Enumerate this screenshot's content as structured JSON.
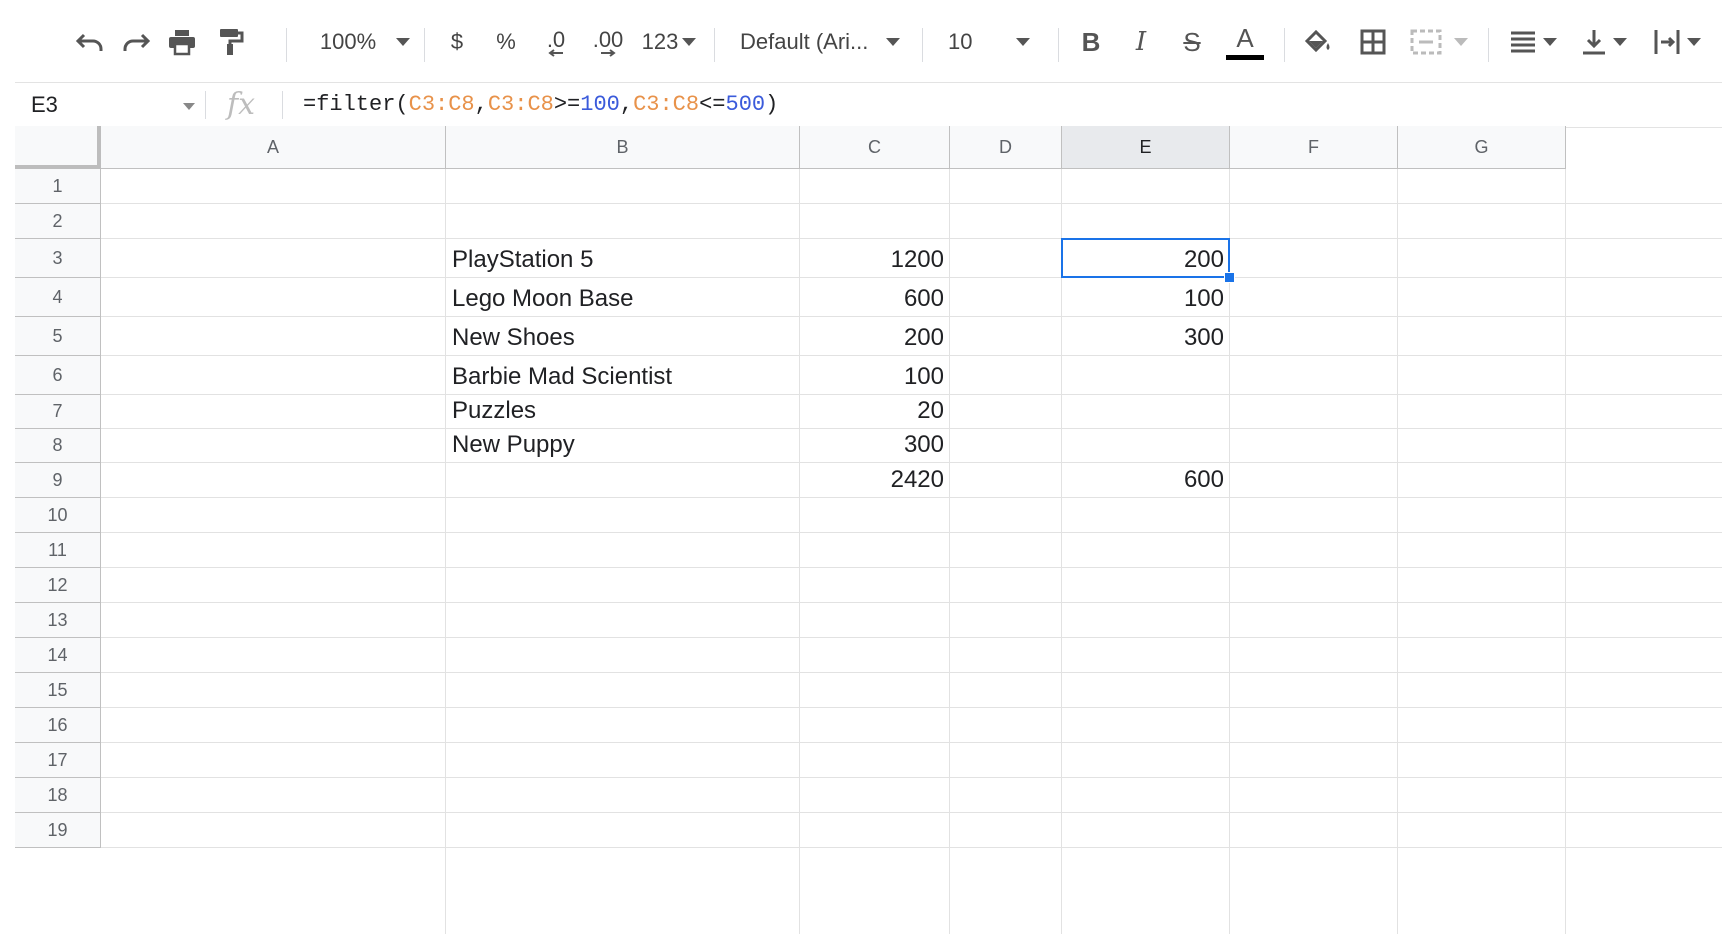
{
  "toolbar": {
    "zoom": "100%",
    "currency_label": "$",
    "percent_label": "%",
    "decrease_decimal_label": ".0",
    "increase_decimal_label": ".00",
    "more_formats_label": "123",
    "font_family": "Default (Ari...",
    "font_size": "10",
    "text_color_swatch": "#000000"
  },
  "formula_bar": {
    "name_box": "E3",
    "fx_label": "fx",
    "formula_parts": {
      "p1": "=filter(",
      "p2": "C3:C8",
      "p3": ",",
      "p4": "C3:C8",
      "p5": ">=",
      "p6": "100",
      "p7": ",",
      "p8": "C3:C8",
      "p9": "<=",
      "p10": "500",
      "p11": ")"
    }
  },
  "sheet": {
    "columns": [
      "A",
      "B",
      "C",
      "D",
      "E",
      "F",
      "G"
    ],
    "selected_column": "E",
    "rows": [
      "1",
      "2",
      "3",
      "4",
      "5",
      "6",
      "7",
      "8",
      "9",
      "10",
      "11",
      "12",
      "13",
      "14",
      "15",
      "16",
      "17",
      "18",
      "19"
    ],
    "cells": {
      "B3": "PlayStation 5",
      "B4": "Lego Moon Base",
      "B5": "New Shoes",
      "B6": "Barbie Mad Scientist",
      "B7": "Puzzles",
      "B8": "New Puppy",
      "C3": "1200",
      "C4": "600",
      "C5": "200",
      "C6": "100",
      "C7": "20",
      "C8": "300",
      "C9": "2420",
      "E3": "200",
      "E4": "100",
      "E5": "300",
      "E9": "600"
    },
    "active_cell": "E3",
    "selection_color": "#1a73e8"
  }
}
